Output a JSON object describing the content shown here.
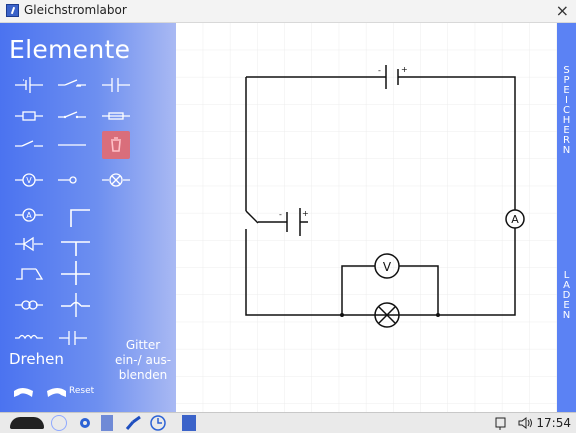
{
  "window": {
    "title": "Gleichstromlabor",
    "close_glyph": "×"
  },
  "sidebar": {
    "title": "Elemente",
    "rotate_label": "Drehen",
    "reset_label": "Reset",
    "grid_toggle_label": "Gitter ein-/ aus- blenden",
    "tools": [
      "battery-icon",
      "switch-open-icon",
      "capacitor-icon",
      "resistor-icon",
      "switch-closed-icon",
      "fuse-icon",
      "switch-icon",
      "wire-icon",
      "trash-icon",
      "voltmeter-icon",
      "terminal-icon",
      "lamp-icon",
      "ammeter-icon",
      "corner-wire-icon",
      "diode-icon",
      "t-wire-icon",
      "transistor-icon",
      "cross-wire-icon",
      "motor-icon",
      "crossing-icon",
      "coil-icon",
      "variable-capacitor-icon"
    ]
  },
  "right_panel": {
    "save_letters": [
      "S",
      "P",
      "E",
      "I",
      "C",
      "H",
      "E",
      "R",
      "N"
    ],
    "load_letters": [
      "L",
      "A",
      "D",
      "E",
      "N"
    ]
  },
  "taskbar": {
    "time": "17:54"
  },
  "circuit": {
    "components": [
      "battery-top",
      "switch-left",
      "battery-left",
      "ammeter-right",
      "voltmeter",
      "lamp"
    ]
  }
}
